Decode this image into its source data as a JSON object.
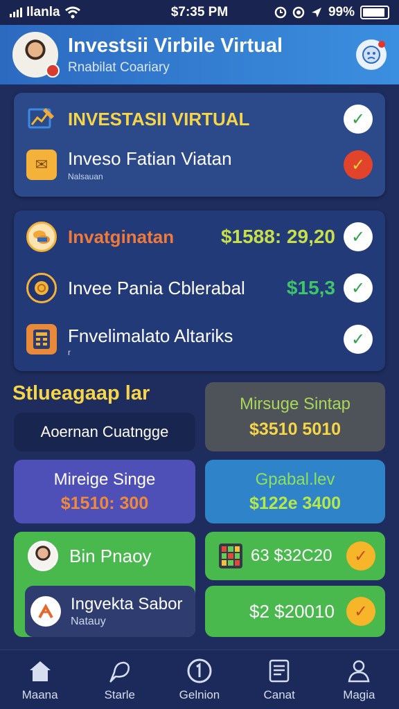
{
  "status_bar": {
    "carrier": "Ilanla",
    "time": "$7:35 PM",
    "battery": "99%"
  },
  "header": {
    "title": "Investsii Virbile Virtual",
    "subtitle": "Rnabilat Coariary"
  },
  "card_top": {
    "rows": [
      {
        "label": "INVESTASII VIRTUAL",
        "sub": "",
        "icon": "chart-pencil-icon",
        "status": "ok"
      },
      {
        "label": "Inveso Fatian Viatan",
        "sub": "Nalsauan",
        "icon": "gold-envelope-icon",
        "status": "warn"
      }
    ]
  },
  "card_mid": {
    "rows": [
      {
        "label": "Invatginatan",
        "value": "$1588: 29,20",
        "icon": "coins-icon",
        "status": "ok"
      },
      {
        "label": "Invee Pania Cblerabal",
        "value": "$15,3",
        "icon": "coin-ring-icon",
        "status": "ok"
      },
      {
        "label": "Fnvelimalato Altariks",
        "value": "",
        "sub": "r",
        "icon": "calculator-icon",
        "status": "ok"
      }
    ]
  },
  "section": {
    "title": "Stlueagaap lar",
    "button_label": "Aoernan Cuatngge"
  },
  "tiles": [
    {
      "line1": "Mirsuge Sintap",
      "line2": "$3510 5010"
    },
    {
      "line1": "Mireige Singe",
      "line2": "$1510: 300"
    },
    {
      "line1": "Gpabal.lev",
      "line2": "$122e 3400"
    }
  ],
  "list_tiles": [
    {
      "label": "Bin Pnaoy",
      "sub": ""
    },
    {
      "label": "Ingvekta Sabor",
      "sub": "Natauy"
    }
  ],
  "value_tiles": [
    {
      "label": "63 $32C20"
    },
    {
      "label": "$2 $20010"
    }
  ],
  "bottom_nav": [
    {
      "label": "Maana",
      "icon": "home-icon"
    },
    {
      "label": "Starle",
      "icon": "pen-bubble-icon"
    },
    {
      "label": "Gelnion",
      "icon": "info-circle-icon"
    },
    {
      "label": "Canat",
      "icon": "document-icon"
    },
    {
      "label": "Magia",
      "icon": "user-icon"
    }
  ],
  "colors": {
    "background": "#1f2d5e",
    "header": "#3b8fe0",
    "accent_yellow": "#f6d548",
    "success_green": "#2fa14b",
    "warn_red": "#e1442a",
    "tile_purple": "#4f4fb8",
    "tile_blue": "#2f84c9",
    "tile_green": "#49b84d"
  }
}
